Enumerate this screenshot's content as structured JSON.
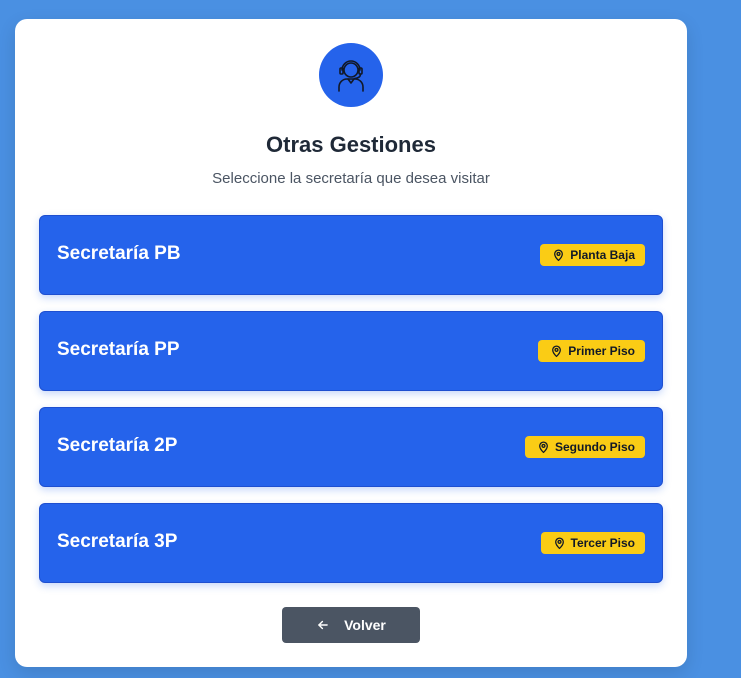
{
  "header": {
    "avatar_icon": "support-agent-icon",
    "title": "Otras Gestiones",
    "subtitle": "Seleccione la secretaría que desea visitar"
  },
  "options": [
    {
      "label": "Secretaría PB",
      "location": "Planta Baja",
      "location_icon": "map-pin-icon"
    },
    {
      "label": "Secretaría PP",
      "location": "Primer Piso",
      "location_icon": "map-pin-icon"
    },
    {
      "label": "Secretaría 2P",
      "location": "Segundo Piso",
      "location_icon": "map-pin-icon"
    },
    {
      "label": "Secretaría 3P",
      "location": "Tercer Piso",
      "location_icon": "map-pin-icon"
    }
  ],
  "back_button": {
    "label": "Volver",
    "icon": "arrow-left-icon"
  },
  "colors": {
    "background": "#4a90e2",
    "card": "#ffffff",
    "option": "#2563eb",
    "badge": "#facc15",
    "back_button": "#4b5563"
  }
}
